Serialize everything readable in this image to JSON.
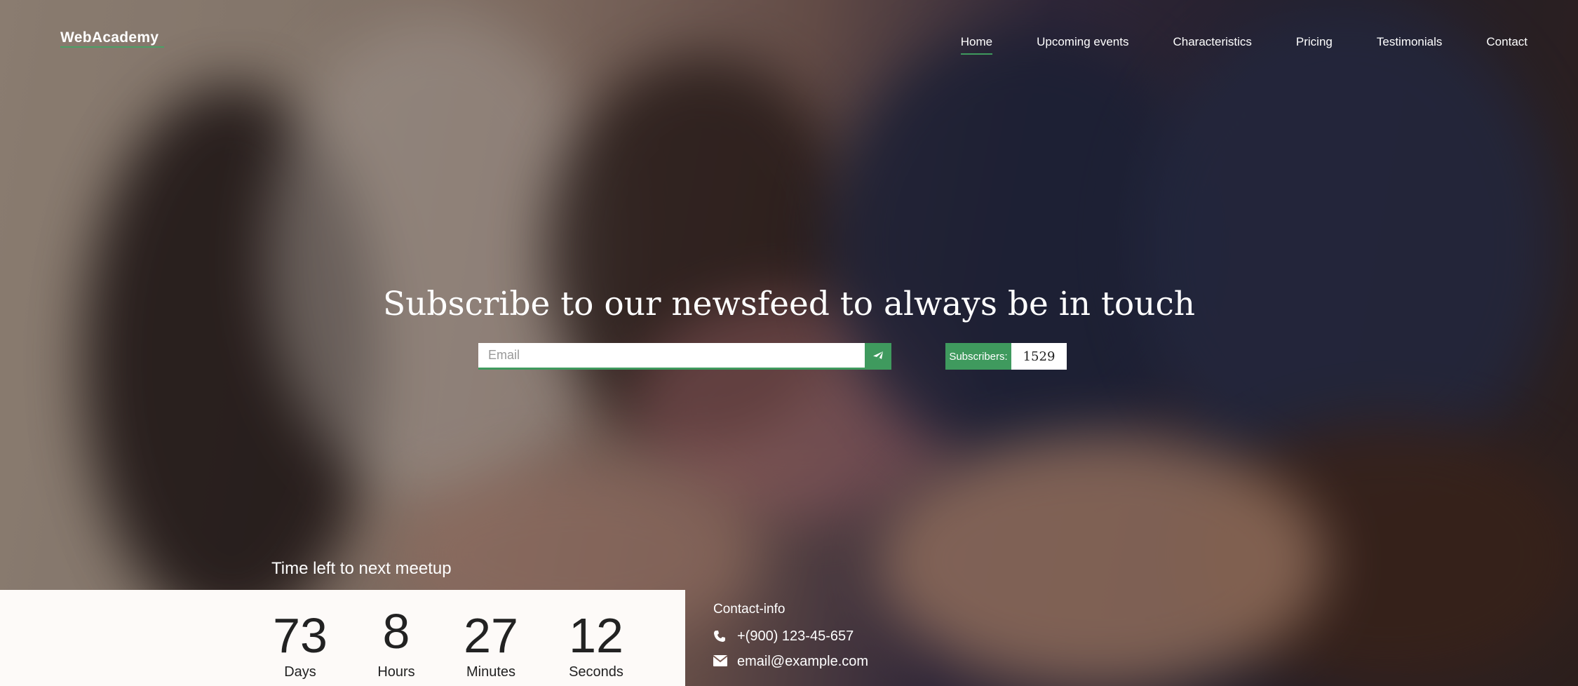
{
  "brand": {
    "logo": "WebAcademy",
    "accent": "#3f9a5e"
  },
  "nav": {
    "items": [
      {
        "label": "Home",
        "active": true
      },
      {
        "label": "Upcoming events"
      },
      {
        "label": "Characteristics"
      },
      {
        "label": "Pricing"
      },
      {
        "label": "Testimonials"
      },
      {
        "label": "Contact"
      }
    ]
  },
  "hero": {
    "title": "Subscribe to our newsfeed to always be in touch",
    "email_placeholder": "Email",
    "subscribers_label": "Subscribers:",
    "subscribers_count": "1529"
  },
  "countdown": {
    "caption": "Time left to next meetup",
    "units": [
      {
        "value": "73",
        "label": "Days"
      },
      {
        "value": "8",
        "label": "Hours"
      },
      {
        "value": "27",
        "label": "Minutes"
      },
      {
        "value": "12",
        "label": "Seconds"
      }
    ]
  },
  "contact": {
    "title": "Contact-info",
    "phone": "+(900) 123-45-657",
    "email": "email@example.com"
  }
}
